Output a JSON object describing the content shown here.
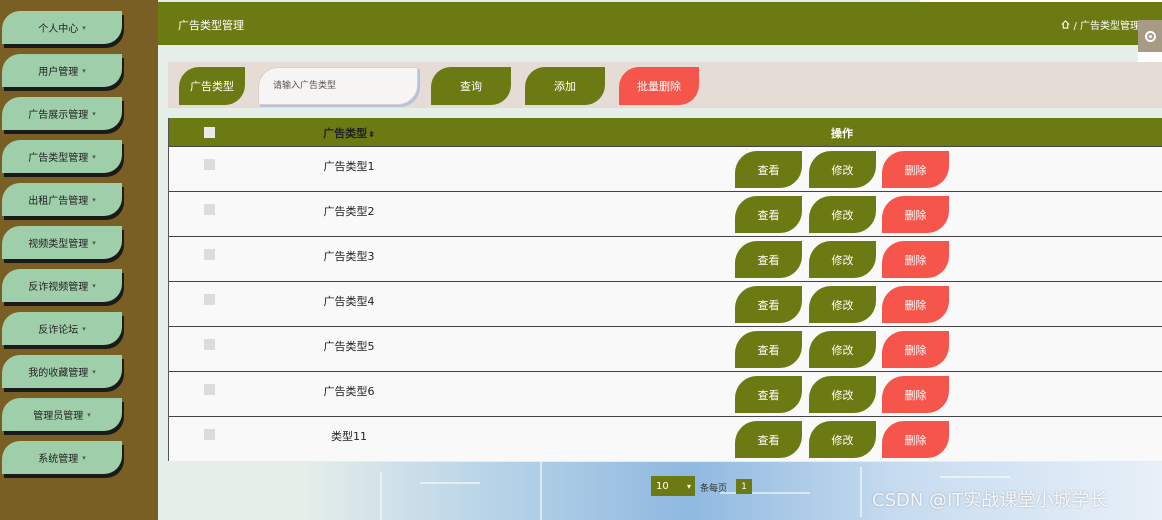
{
  "sidebar": {
    "items": [
      {
        "label": "个人中心"
      },
      {
        "label": "用户管理"
      },
      {
        "label": "广告展示管理"
      },
      {
        "label": "广告类型管理"
      },
      {
        "label": "出租广告管理"
      },
      {
        "label": "视频类型管理"
      },
      {
        "label": "反诈视频管理"
      },
      {
        "label": "反诈论坛"
      },
      {
        "label": "我的收藏管理"
      },
      {
        "label": "管理员管理"
      },
      {
        "label": "系统管理"
      }
    ],
    "caret": "▾"
  },
  "header": {
    "title": "广告类型管理",
    "breadcrumb": "/ 广告类型管理"
  },
  "search": {
    "label": "广告类型",
    "placeholder": "请输入广告类型",
    "query_label": "查询",
    "add_label": "添加",
    "batch_delete_label": "批量删除"
  },
  "table": {
    "columns": {
      "name": "广告类型",
      "sort": "⬍",
      "actions": "操作"
    },
    "rows": [
      {
        "name": "广告类型1"
      },
      {
        "name": "广告类型2"
      },
      {
        "name": "广告类型3"
      },
      {
        "name": "广告类型4"
      },
      {
        "name": "广告类型5"
      },
      {
        "name": "广告类型6"
      },
      {
        "name": "类型11"
      }
    ],
    "actions": {
      "view": "查看",
      "edit": "修改",
      "delete": "删除"
    }
  },
  "pagination": {
    "page_size": "10",
    "per_page_text": "条每页",
    "current_page": "1"
  },
  "watermark": "CSDN @IT实战课堂小城学长",
  "colors": {
    "olive": "#6b7a12",
    "sidebar": "#7a5f24",
    "nav_item": "#9fceaa",
    "danger": "#f5554a"
  }
}
